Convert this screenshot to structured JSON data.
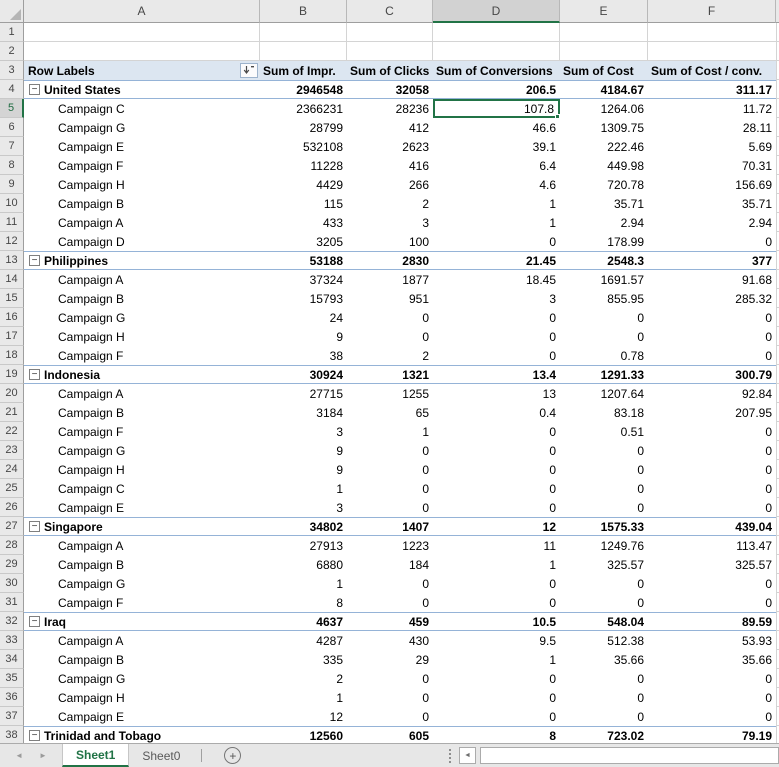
{
  "colors": {
    "accent_green": "#217346",
    "header_bg": "#E9E9E9",
    "selected_header_bg": "#D2D2D2",
    "pivot_header_bg": "#DCE6F1",
    "pivot_border_blue": "#95B3D7",
    "gridline": "#D4D4D4"
  },
  "columns": {
    "letters": [
      "A",
      "B",
      "C",
      "D",
      "E",
      "F"
    ],
    "widths": [
      236,
      87,
      86,
      127,
      88,
      128
    ],
    "selected": "D"
  },
  "rows": {
    "first_number": 1,
    "empty_rows": 2,
    "last_number": 38
  },
  "selection": {
    "address": "D5",
    "row_number": 5,
    "column": "D",
    "value": "107.8"
  },
  "icons": {
    "select_all": "select-all-triangle-icon",
    "collapse_glyph": "−",
    "prev_arrow": "◄",
    "next_arrow": "►",
    "add_sheet": "+",
    "scroll_left": "◄"
  },
  "pivot": {
    "header": {
      "row_labels": "Row Labels",
      "value_headers": [
        "Sum of Impr.",
        "Sum of Clicks",
        "Sum of Conversions",
        "Sum of Cost",
        "Sum of Cost / conv."
      ]
    },
    "groups": [
      {
        "name": "United States",
        "totals": [
          "2946548",
          "32058",
          "206.5",
          "4184.67",
          "311.17"
        ],
        "rows": [
          {
            "name": "Campaign C",
            "values": [
              "2366231",
              "28236",
              "107.8",
              "1264.06",
              "11.72"
            ]
          },
          {
            "name": "Campaign G",
            "values": [
              "28799",
              "412",
              "46.6",
              "1309.75",
              "28.11"
            ]
          },
          {
            "name": "Campaign E",
            "values": [
              "532108",
              "2623",
              "39.1",
              "222.46",
              "5.69"
            ]
          },
          {
            "name": "Campaign F",
            "values": [
              "11228",
              "416",
              "6.4",
              "449.98",
              "70.31"
            ]
          },
          {
            "name": "Campaign H",
            "values": [
              "4429",
              "266",
              "4.6",
              "720.78",
              "156.69"
            ]
          },
          {
            "name": "Campaign B",
            "values": [
              "115",
              "2",
              "1",
              "35.71",
              "35.71"
            ]
          },
          {
            "name": "Campaign A",
            "values": [
              "433",
              "3",
              "1",
              "2.94",
              "2.94"
            ]
          },
          {
            "name": "Campaign D",
            "values": [
              "3205",
              "100",
              "0",
              "178.99",
              "0"
            ]
          }
        ]
      },
      {
        "name": "Philippines",
        "totals": [
          "53188",
          "2830",
          "21.45",
          "2548.3",
          "377"
        ],
        "rows": [
          {
            "name": "Campaign A",
            "values": [
              "37324",
              "1877",
              "18.45",
              "1691.57",
              "91.68"
            ]
          },
          {
            "name": "Campaign B",
            "values": [
              "15793",
              "951",
              "3",
              "855.95",
              "285.32"
            ]
          },
          {
            "name": "Campaign G",
            "values": [
              "24",
              "0",
              "0",
              "0",
              "0"
            ]
          },
          {
            "name": "Campaign H",
            "values": [
              "9",
              "0",
              "0",
              "0",
              "0"
            ]
          },
          {
            "name": "Campaign F",
            "values": [
              "38",
              "2",
              "0",
              "0.78",
              "0"
            ]
          }
        ]
      },
      {
        "name": "Indonesia",
        "totals": [
          "30924",
          "1321",
          "13.4",
          "1291.33",
          "300.79"
        ],
        "rows": [
          {
            "name": "Campaign A",
            "values": [
              "27715",
              "1255",
              "13",
              "1207.64",
              "92.84"
            ]
          },
          {
            "name": "Campaign B",
            "values": [
              "3184",
              "65",
              "0.4",
              "83.18",
              "207.95"
            ]
          },
          {
            "name": "Campaign F",
            "values": [
              "3",
              "1",
              "0",
              "0.51",
              "0"
            ]
          },
          {
            "name": "Campaign G",
            "values": [
              "9",
              "0",
              "0",
              "0",
              "0"
            ]
          },
          {
            "name": "Campaign H",
            "values": [
              "9",
              "0",
              "0",
              "0",
              "0"
            ]
          },
          {
            "name": "Campaign C",
            "values": [
              "1",
              "0",
              "0",
              "0",
              "0"
            ]
          },
          {
            "name": "Campaign E",
            "values": [
              "3",
              "0",
              "0",
              "0",
              "0"
            ]
          }
        ]
      },
      {
        "name": "Singapore",
        "totals": [
          "34802",
          "1407",
          "12",
          "1575.33",
          "439.04"
        ],
        "rows": [
          {
            "name": "Campaign A",
            "values": [
              "27913",
              "1223",
              "11",
              "1249.76",
              "113.47"
            ]
          },
          {
            "name": "Campaign B",
            "values": [
              "6880",
              "184",
              "1",
              "325.57",
              "325.57"
            ]
          },
          {
            "name": "Campaign G",
            "values": [
              "1",
              "0",
              "0",
              "0",
              "0"
            ]
          },
          {
            "name": "Campaign F",
            "values": [
              "8",
              "0",
              "0",
              "0",
              "0"
            ]
          }
        ]
      },
      {
        "name": "Iraq",
        "totals": [
          "4637",
          "459",
          "10.5",
          "548.04",
          "89.59"
        ],
        "rows": [
          {
            "name": "Campaign A",
            "values": [
              "4287",
              "430",
              "9.5",
              "512.38",
              "53.93"
            ]
          },
          {
            "name": "Campaign B",
            "values": [
              "335",
              "29",
              "1",
              "35.66",
              "35.66"
            ]
          },
          {
            "name": "Campaign G",
            "values": [
              "2",
              "0",
              "0",
              "0",
              "0"
            ]
          },
          {
            "name": "Campaign H",
            "values": [
              "1",
              "0",
              "0",
              "0",
              "0"
            ]
          },
          {
            "name": "Campaign E",
            "values": [
              "12",
              "0",
              "0",
              "0",
              "0"
            ]
          }
        ]
      },
      {
        "name": "Trinidad and Tobago",
        "totals": [
          "12560",
          "605",
          "8",
          "723.02",
          "79.19"
        ],
        "rows": []
      }
    ]
  },
  "sheet_tabs": {
    "tabs": [
      "Sheet1",
      "Sheet0"
    ],
    "active": "Sheet1"
  }
}
